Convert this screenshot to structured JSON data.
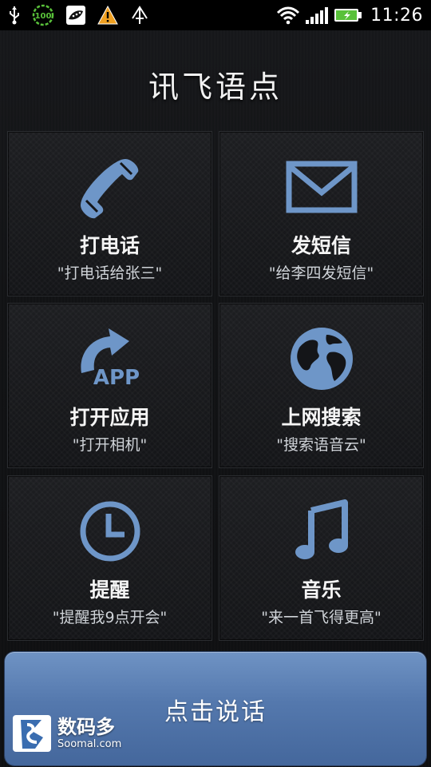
{
  "status_bar": {
    "clock": "11:26",
    "battery_badge": "100",
    "icons": [
      "usb-icon",
      "battery-saver-icon",
      "app-notification-icon",
      "warning-icon",
      "antenna-icon",
      "wifi-icon",
      "signal-icon",
      "battery-icon"
    ]
  },
  "app": {
    "title": "讯飞语点"
  },
  "tiles": [
    {
      "title": "打电话",
      "subtitle": "\"打电话给张三\"",
      "icon": "phone-icon"
    },
    {
      "title": "发短信",
      "subtitle": "\"给李四发短信\"",
      "icon": "mail-icon"
    },
    {
      "title": "打开应用",
      "subtitle": "\"打开相机\"",
      "icon": "app-icon",
      "icon_text": "APP"
    },
    {
      "title": "上网搜索",
      "subtitle": "\"搜索语音云\"",
      "icon": "globe-icon"
    },
    {
      "title": "提醒",
      "subtitle": "\"提醒我9点开会\"",
      "icon": "clock-icon"
    },
    {
      "title": "音乐",
      "subtitle": "\"来一首飞得更高\"",
      "icon": "music-icon"
    }
  ],
  "speak_button": {
    "label": "点击说话"
  },
  "watermark": {
    "cn": "数码多",
    "en": "Soomal.com"
  },
  "colors": {
    "accent": "#6e96c8",
    "button": "#5478ad",
    "battery_green": "#59c13a"
  }
}
